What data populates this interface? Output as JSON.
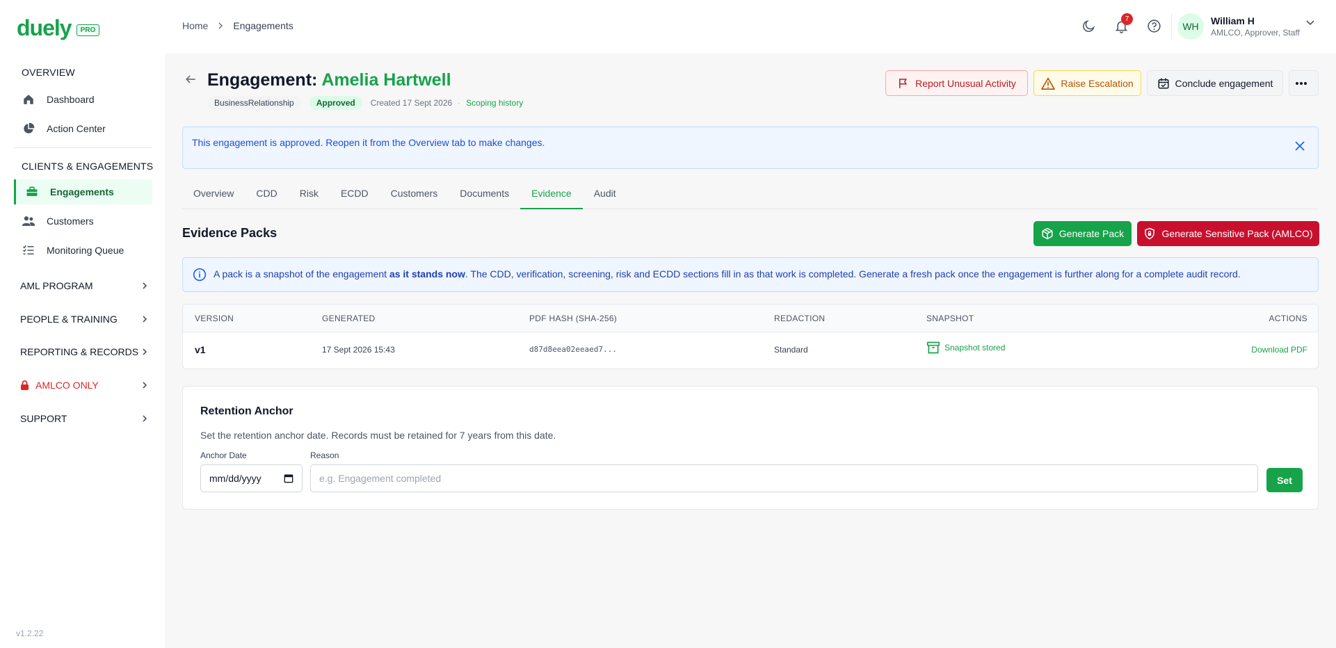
{
  "brand": {
    "name": "duely",
    "badge": "PRO"
  },
  "sidebar": {
    "overview_section": "OVERVIEW",
    "overview_items": [
      {
        "label": "Dashboard",
        "icon": "home-icon"
      },
      {
        "label": "Action Center",
        "icon": "pie-chart-icon"
      }
    ],
    "clients_section": "CLIENTS & ENGAGEMENTS",
    "clients_items": [
      {
        "label": "Engagements",
        "icon": "briefcase-icon",
        "active": true
      },
      {
        "label": "Customers",
        "icon": "users-icon"
      },
      {
        "label": "Monitoring Queue",
        "icon": "list-check-icon"
      }
    ],
    "groups": [
      {
        "label": "AML PROGRAM"
      },
      {
        "label": "PEOPLE & TRAINING"
      },
      {
        "label": "REPORTING & RECORDS"
      },
      {
        "label": "AMLCO ONLY",
        "icon": "lock-icon"
      },
      {
        "label": "SUPPORT"
      }
    ],
    "version": "v1.2.22"
  },
  "topbar": {
    "breadcrumb": {
      "home": "Home",
      "current": "Engagements"
    },
    "notifications_count": "7",
    "user": {
      "initials": "WH",
      "name": "William H",
      "role": "AMLCO, Approver, Staff"
    }
  },
  "header": {
    "title_prefix": "Engagement: ",
    "client_name": "Amelia Hartwell",
    "type_tag": "BusinessRelationship",
    "status_tag": "Approved",
    "created": "Created 17 Sept 2026",
    "separator": "·",
    "scoping_link": "Scoping history",
    "report_label": "Report Unusual Activity",
    "escalate_label": "Raise Escalation",
    "conclude_label": "Conclude engagement",
    "more_label": "···"
  },
  "banner": {
    "text": "This engagement is approved. Reopen it from the Overview tab to make changes."
  },
  "tabs": [
    "Overview",
    "CDD",
    "Risk",
    "ECDD",
    "Customers",
    "Documents",
    "Evidence",
    "Audit"
  ],
  "active_tab": "Evidence",
  "evidence": {
    "title": "Evidence Packs",
    "generate_label": "Generate Pack",
    "generate_sensitive_label": "Generate Sensitive Pack (AMLCO)",
    "info_pre": "A pack is a snapshot of the engagement ",
    "info_bold": "as it stands now",
    "info_post": ". The CDD, verification, screening, risk and ECDD sections fill in as that work is completed. Generate a fresh pack once the engagement is further along for a complete audit record.",
    "columns": {
      "version": "VERSION",
      "generated": "GENERATED",
      "hash": "PDF HASH (SHA-256)",
      "redaction": "REDACTION",
      "snapshot": "SNAPSHOT",
      "actions": "ACTIONS"
    },
    "rows": [
      {
        "version": "v1",
        "generated": "17 Sept 2026 15:43",
        "hash": "d87d8eea02eeaed7...",
        "redaction": "Standard",
        "snapshot": "Snapshot stored",
        "action": "Download PDF"
      }
    ]
  },
  "retention": {
    "title": "Retention Anchor",
    "description": "Set the retention anchor date. Records must be retained for 7 years from this date.",
    "date_label": "Anchor Date",
    "date_placeholder": "mm/dd/yyyy",
    "reason_label": "Reason",
    "reason_placeholder": "e.g. Engagement completed",
    "set_label": "Set"
  },
  "colors": {
    "accent": "#16a34a",
    "danger": "#c8102e",
    "info_bg": "#eff6ff"
  }
}
